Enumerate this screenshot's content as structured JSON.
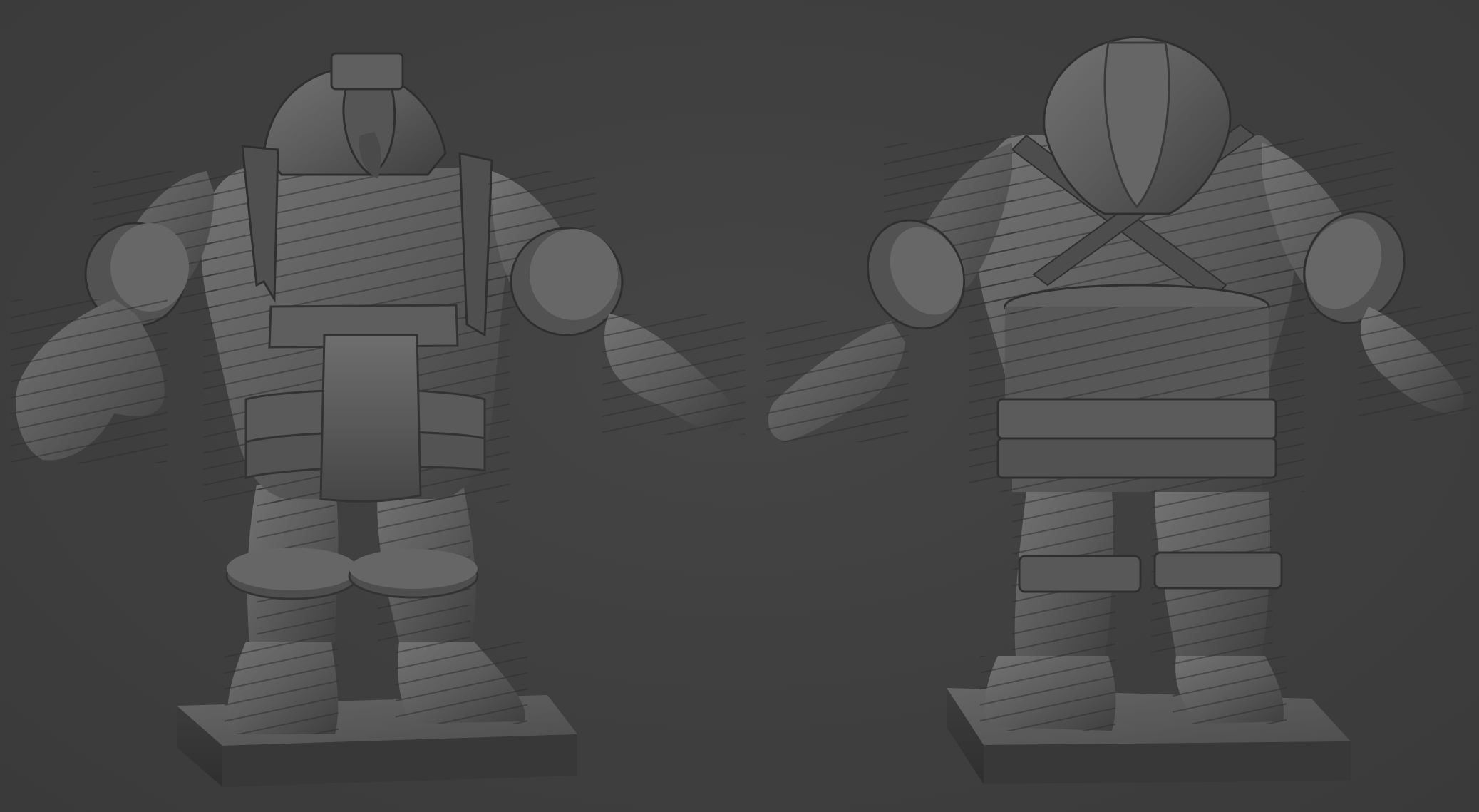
{
  "scene": {
    "background_color": "#3f3f3f",
    "clay_color": "#5a5a5a",
    "clay_highlight": "#757575",
    "clay_shadow": "#3a3a3a",
    "views": [
      {
        "view": "front"
      },
      {
        "view": "back"
      }
    ]
  }
}
